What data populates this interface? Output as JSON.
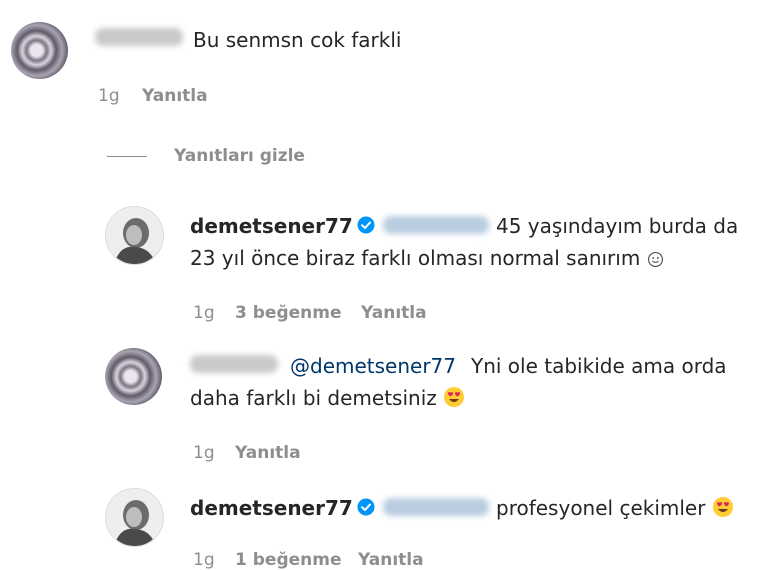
{
  "comments": [
    {
      "id": "c1",
      "text": "Bu senmsn cok farkli",
      "time": "1g",
      "reply": "Yanıtla"
    },
    {
      "id": "c2",
      "username": "demetsener77",
      "text_line1": "45 yaşındayım burda da",
      "text_line2": "23 yıl önce biraz farklı olması normal sanırım",
      "time": "1g",
      "likes": "3 beğenme",
      "reply": "Yanıtla"
    },
    {
      "id": "c3",
      "mention": "@demetsener77",
      "text_line1": "Yni ole tabikide ama orda",
      "text_line2": "daha farklı bi demetsiniz",
      "time": "1g",
      "reply": "Yanıtla"
    },
    {
      "id": "c4",
      "username": "demetsener77",
      "text": "profesyonel çekimler",
      "time": "1g",
      "likes": "1 beğenme",
      "reply": "Yanıtla"
    }
  ],
  "hide_replies": "Yanıtları gizle",
  "colors": {
    "text": "#262626",
    "meta": "#8e8e8e",
    "verified": "#0095f6",
    "mention": "#00376b"
  }
}
